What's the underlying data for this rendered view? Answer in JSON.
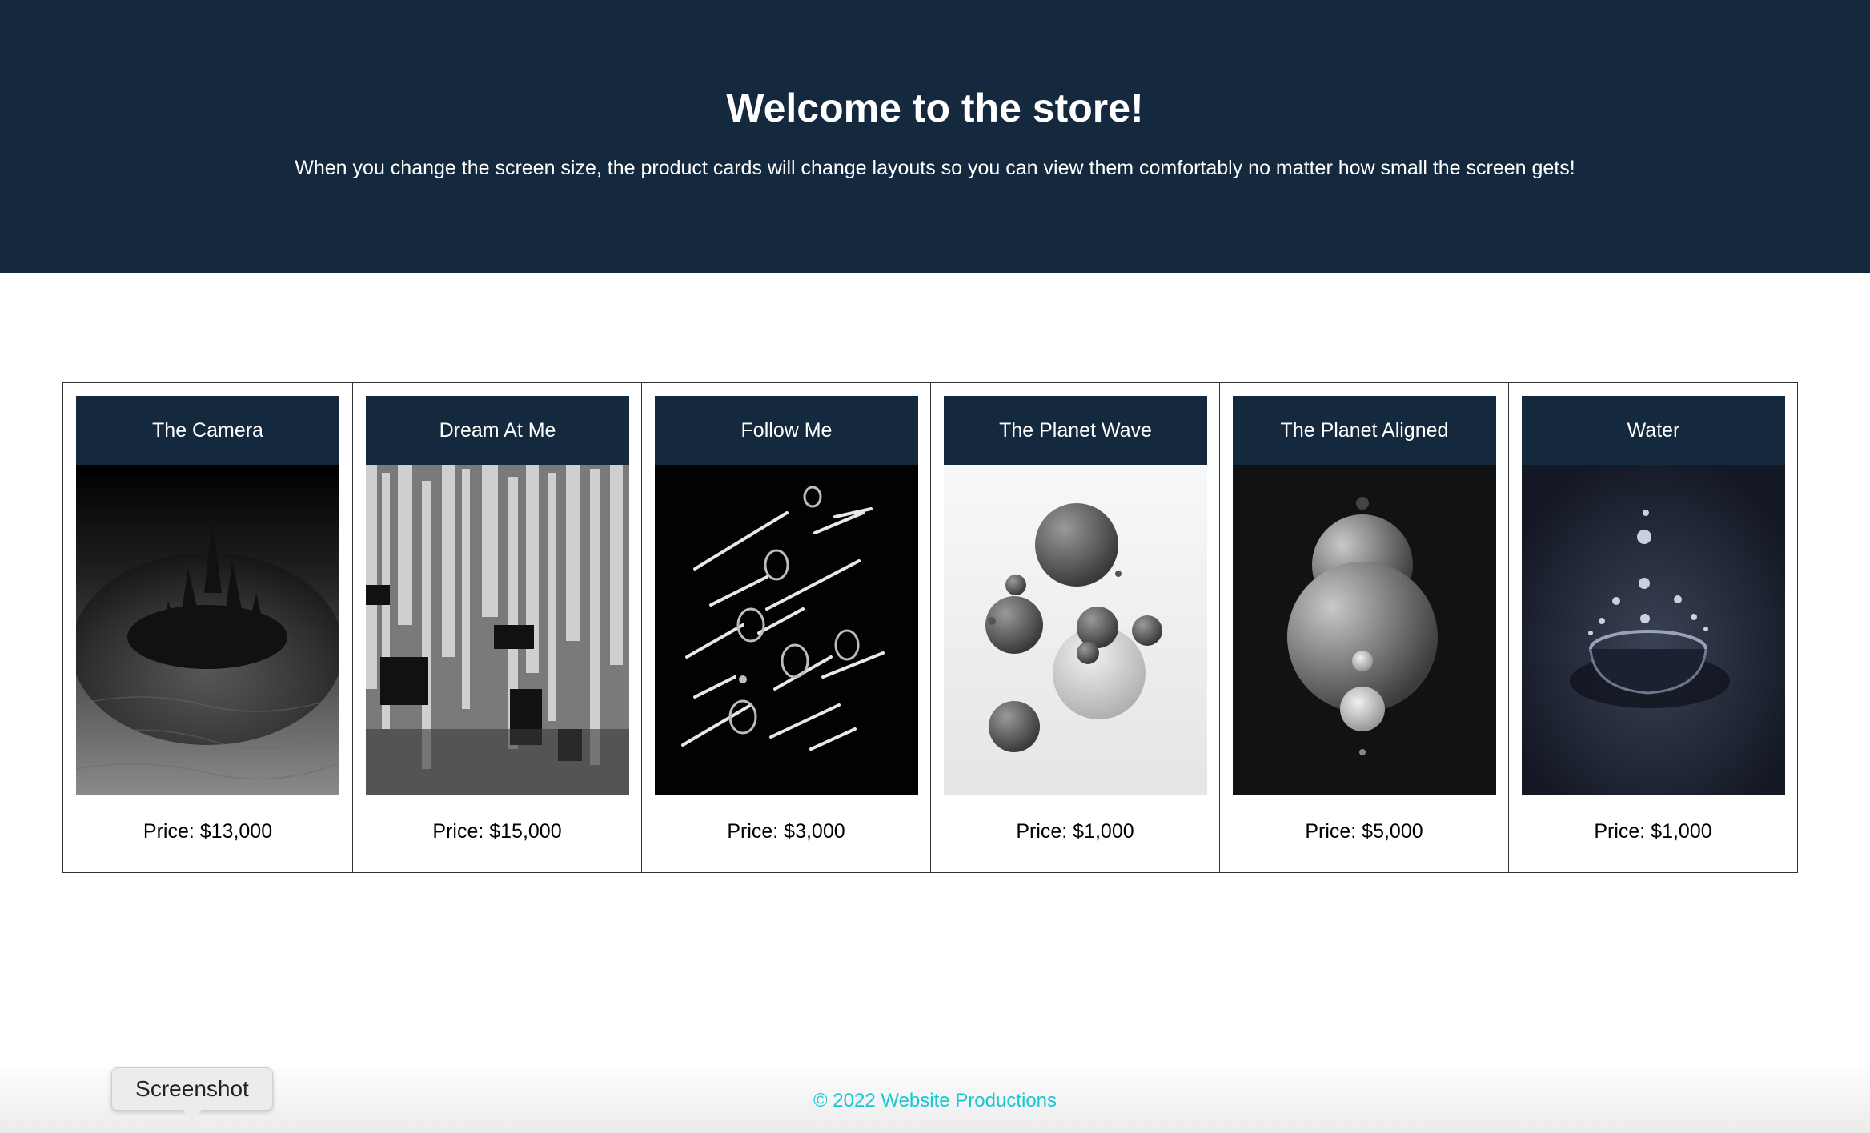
{
  "hero": {
    "title": "Welcome to the store!",
    "subtitle": "When you change the screen size, the product cards will change layouts so you can view them comfortably no matter how small the screen gets!"
  },
  "products": [
    {
      "title": "The Camera",
      "price": "Price: $13,000",
      "image": "dark-spiky-landscape-image"
    },
    {
      "title": "Dream At Me",
      "price": "Price: $15,000",
      "image": "glitch-texture-image"
    },
    {
      "title": "Follow Me",
      "price": "Price: $3,000",
      "image": "chrome-tubes-image"
    },
    {
      "title": "The Planet Wave",
      "price": "Price: $1,000",
      "image": "floating-spheres-image"
    },
    {
      "title": "The Planet Aligned",
      "price": "Price: $5,000",
      "image": "aligned-spheres-image"
    },
    {
      "title": "Water",
      "price": "Price: $1,000",
      "image": "water-splash-image"
    }
  ],
  "footer": {
    "text": "© 2022 Website Productions"
  },
  "tooltip": {
    "text": "Screenshot"
  },
  "colors": {
    "header_bg": "#14293d",
    "footer_text": "#17c7d3"
  }
}
